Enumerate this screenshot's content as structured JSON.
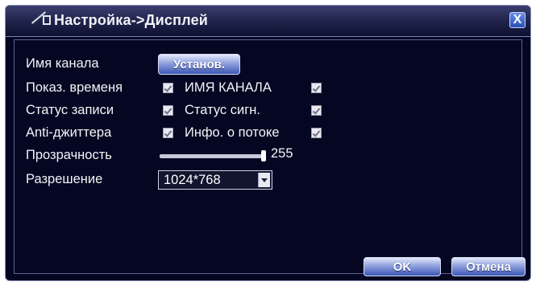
{
  "window": {
    "title": "Настройка->Дисплей",
    "close_symbol": "X"
  },
  "fields": {
    "channel_name_label": "Имя канала",
    "channel_name_button": "Установ.",
    "show_time_label": "Показ. временя",
    "channel_name_overlay_label": "ИМЯ КАНАЛА",
    "record_status_label": "Статус записи",
    "signal_status_label": "Статус сигн.",
    "anti_jitter_label": "Anti-джиттера",
    "stream_info_label": "Инфо. о потоке",
    "transparency_label": "Прозрачность",
    "transparency_value": "255",
    "transparency_fraction": 1.0,
    "resolution_label": "Разрешение",
    "resolution_value": "1024*768"
  },
  "checkboxes": {
    "show_time": true,
    "channel_name_overlay": true,
    "record_status": true,
    "signal_status": true,
    "anti_jitter": true,
    "stream_info": true
  },
  "buttons": {
    "ok": "OK",
    "cancel": "Отмена"
  },
  "colors": {
    "background": "#040622",
    "title_gradient_top": "#3a3f6f",
    "button_blue": "#3b57b6",
    "text": "#f4f4f6"
  }
}
